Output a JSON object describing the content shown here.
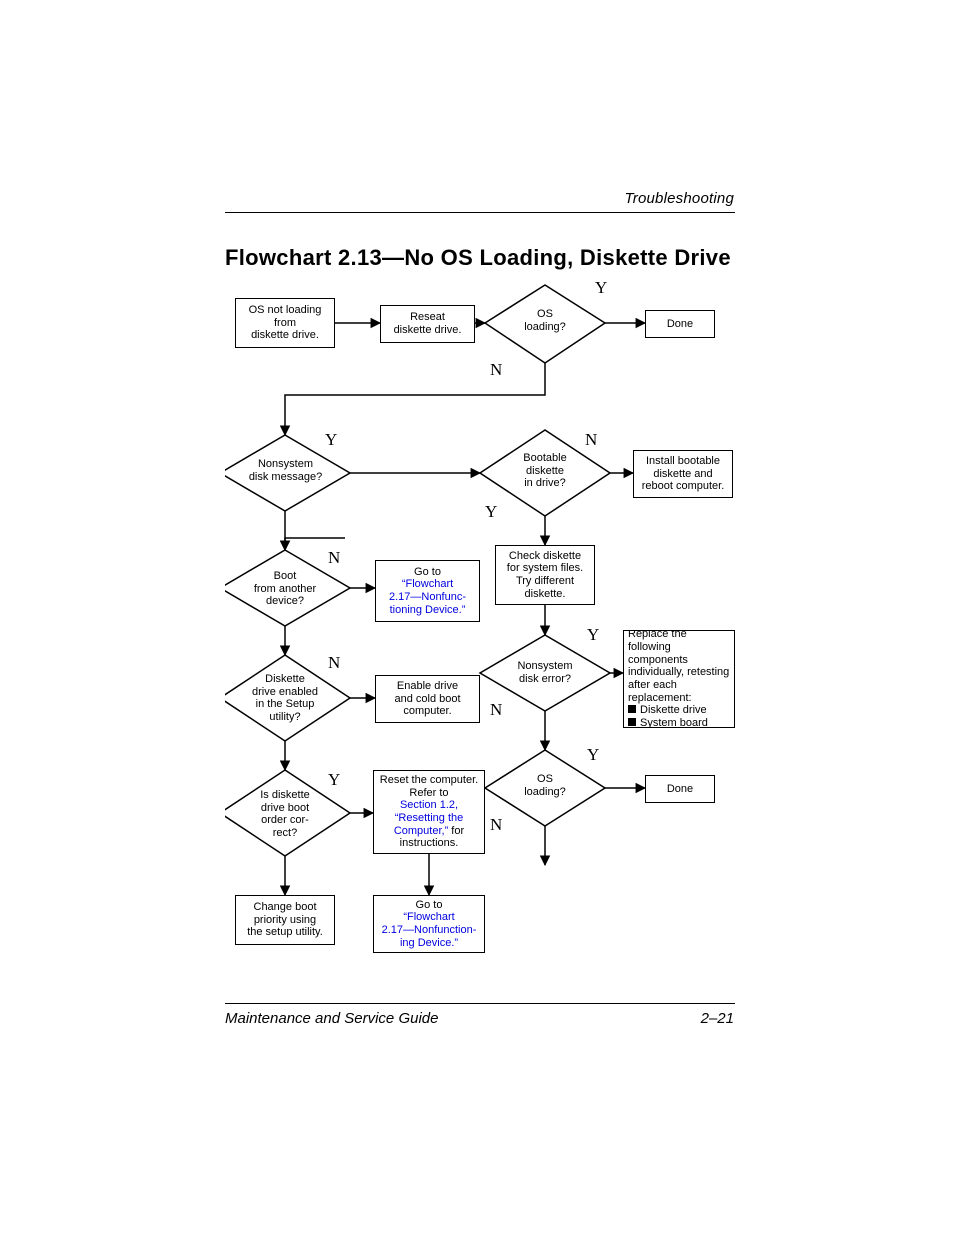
{
  "header": "Troubleshooting",
  "footer_left": "Maintenance and Service Guide",
  "footer_right": "2–21",
  "title": "Flowchart 2.13—No OS Loading, Diskette Drive",
  "labels": {
    "Y": "Y",
    "N": "N"
  },
  "boxes": {
    "start": "OS not loading<br>from<br>diskette drive.",
    "reseat": "Reseat<br>diskette drive.",
    "done1": "Done",
    "install_boot": "Install bootable<br>diskette and<br>reboot computer.",
    "check_sys": "Check diskette<br>for system files.<br>Try different<br>diskette.",
    "replace_components_pre": "Replace the following<br>components<br>individually, retesting<br>after each<br>replacement:",
    "replace_item1": "Diskette drive",
    "replace_item2": "System board",
    "done2": "Done",
    "enable_drive": "Enable drive<br>and cold boot<br>computer.",
    "change_priority": "Change boot<br>priority using<br>the setup utility.",
    "goto_217_pre": "Go to",
    "goto_217_link": "“Flowchart<br>2.17—Nonfunc-<br>tioning Device.”",
    "reset_pre": "Reset the computer.<br>Refer to",
    "reset_link": "Section 1.2,<br>“Resetting the<br>Computer,”",
    "reset_post": " for<br>instructions.",
    "goto_217b_pre": "Go to",
    "goto_217b_link": "“Flowchart<br>2.17—Nonfunction-<br>ing Device.”"
  },
  "diamonds": {
    "os_loading1": "OS<br>loading?",
    "nonsys_msg": "Nonsystem<br>disk message?",
    "bootable_in_drive": "Bootable<br>diskette<br>in drive?",
    "boot_from_another": "Boot<br>from another<br>device?",
    "drive_enabled": "Diskette<br>drive enabled<br>in the Setup<br>utility?",
    "boot_order": "Is diskette<br>drive boot<br>order cor-<br>rect?",
    "nonsys_error": "Nonsystem<br>disk error?",
    "os_loading2": "OS<br>loading?"
  }
}
